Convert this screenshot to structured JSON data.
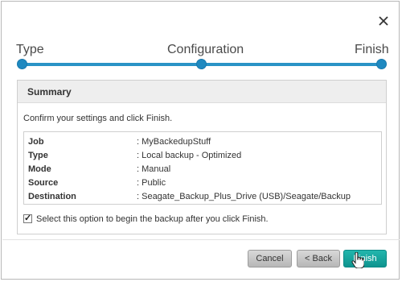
{
  "wizard": {
    "steps": [
      "Type",
      "Configuration",
      "Finish"
    ]
  },
  "summary": {
    "title": "Summary",
    "confirm_text": "Confirm your settings and click Finish.",
    "rows": [
      {
        "key": "Job",
        "value": ": MyBackedupStuff"
      },
      {
        "key": "Type",
        "value": ": Local backup - Optimized"
      },
      {
        "key": "Mode",
        "value": ": Manual"
      },
      {
        "key": "Source",
        "value": ": Public"
      },
      {
        "key": "Destination",
        "value": ": Seagate_Backup_Plus_Drive (USB)/Seagate/Backup"
      }
    ],
    "checkbox_label": "Select this option to begin the backup after you click Finish.",
    "checkbox_checked": true
  },
  "buttons": {
    "cancel": "Cancel",
    "back": "< Back",
    "finish": "Finish"
  },
  "icons": {
    "close": "close-icon",
    "cursor": "hand-pointer-icon"
  },
  "colors": {
    "step_accent": "#2a93c6",
    "primary_button": "#13a39c"
  }
}
